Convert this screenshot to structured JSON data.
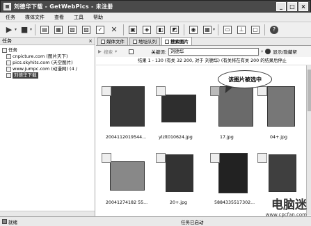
{
  "window": {
    "title": "刘德华下载 - GetWebPics - 未注册",
    "min": "_",
    "max": "□",
    "close": "×"
  },
  "menu": [
    "任务",
    "媒体文件",
    "查看",
    "工具",
    "帮助"
  ],
  "left_panel": {
    "title": "任务",
    "close": "×",
    "root": "任务",
    "items": [
      "cnpicture.com (图片天下)",
      "pics.skyhits.com (天空图片)",
      "www.jumpc.com (动漫网) (4 /",
      "刘德华下载"
    ]
  },
  "tabs": [
    "媒体文件",
    "地址队列",
    "搜索图片"
  ],
  "search": {
    "search_btn": "搜索",
    "keyword_label": "关键词:",
    "keyword_value": "刘德华",
    "show_hide": "显示/隐藏帮"
  },
  "result_text": "结果 1 - 130 (有关 32 200, 对于 刘德华) (有关将在有关 200 的结果后停止",
  "thumbnails": [
    {
      "caption": "2004112019544..."
    },
    {
      "caption": "ylzlt010624.jpg"
    },
    {
      "caption": "17.jpg"
    },
    {
      "caption": "04+.jpg"
    },
    {
      "caption": "20041274182 55..."
    },
    {
      "caption": "20+.jpg"
    },
    {
      "caption": "5884335517302..."
    },
    {
      "caption": ""
    }
  ],
  "callout": "该图片被选中",
  "status": {
    "left": "就绪",
    "middle": "任务已启动"
  },
  "watermark": {
    "main": "电脑迷",
    "sub": "www.cpcfan.com"
  }
}
